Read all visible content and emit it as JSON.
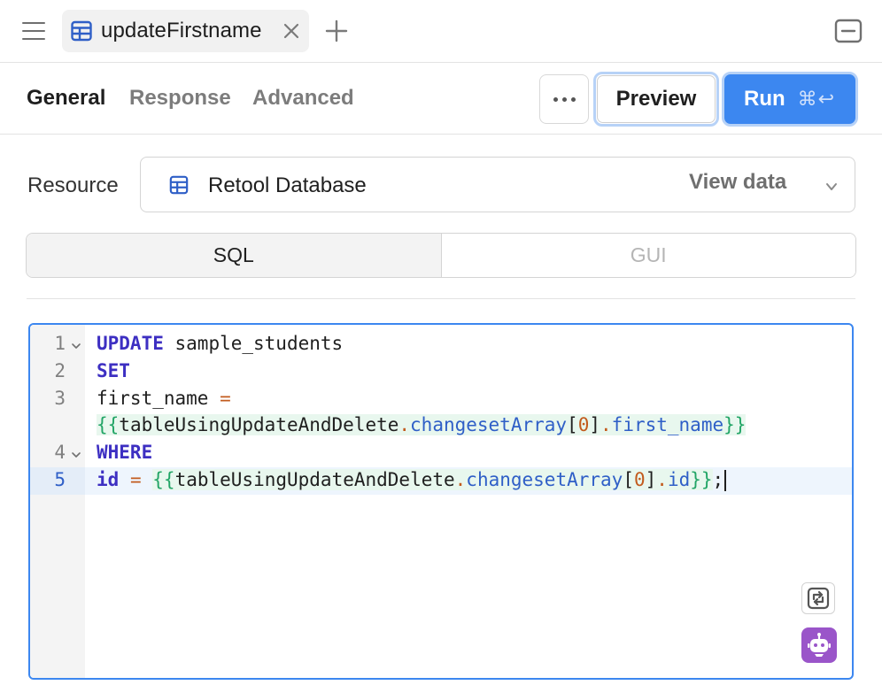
{
  "tab": {
    "title": "updateFirstname",
    "icon": "table-icon",
    "close_icon": "close-icon",
    "add_icon": "plus-icon",
    "menu_icon": "hamburger-menu-icon",
    "collapse_icon": "collapse-panel-icon"
  },
  "toolbar": {
    "tabs": [
      "General",
      "Response",
      "Advanced"
    ],
    "active_tab": "General",
    "more_icon": "more-horizontal-icon",
    "preview_label": "Preview",
    "run_label": "Run",
    "run_shortcut": "⌘↩",
    "accent_color": "#3c87f0"
  },
  "resource": {
    "label": "Resource",
    "selected": "Retool Database",
    "icon": "table-icon",
    "view_data_label": "View data",
    "chevron_icon": "chevron-down-icon"
  },
  "mode": {
    "options": [
      "SQL",
      "GUI"
    ],
    "selected": "SQL"
  },
  "editor": {
    "line_numbers": [
      "1",
      "2",
      "3",
      "4",
      "5"
    ],
    "tokens": {
      "update": "UPDATE",
      "table": "sample_students",
      "set": "SET",
      "first_name": "first_name",
      "eq": "=",
      "open": "{{",
      "close": "}}",
      "component": "tableUsingUpdateAndDelete",
      "dot": ".",
      "changeset": "changesetArray",
      "lbracket": "[",
      "index": "0",
      "rbracket": "]",
      "first_name_prop": "first_name",
      "where": "WHERE",
      "id": "id",
      "id_prop": "id",
      "semicolon": ";"
    },
    "format_icon": "format-code-icon",
    "ai_icon": "ai-assistant-robot-icon"
  }
}
